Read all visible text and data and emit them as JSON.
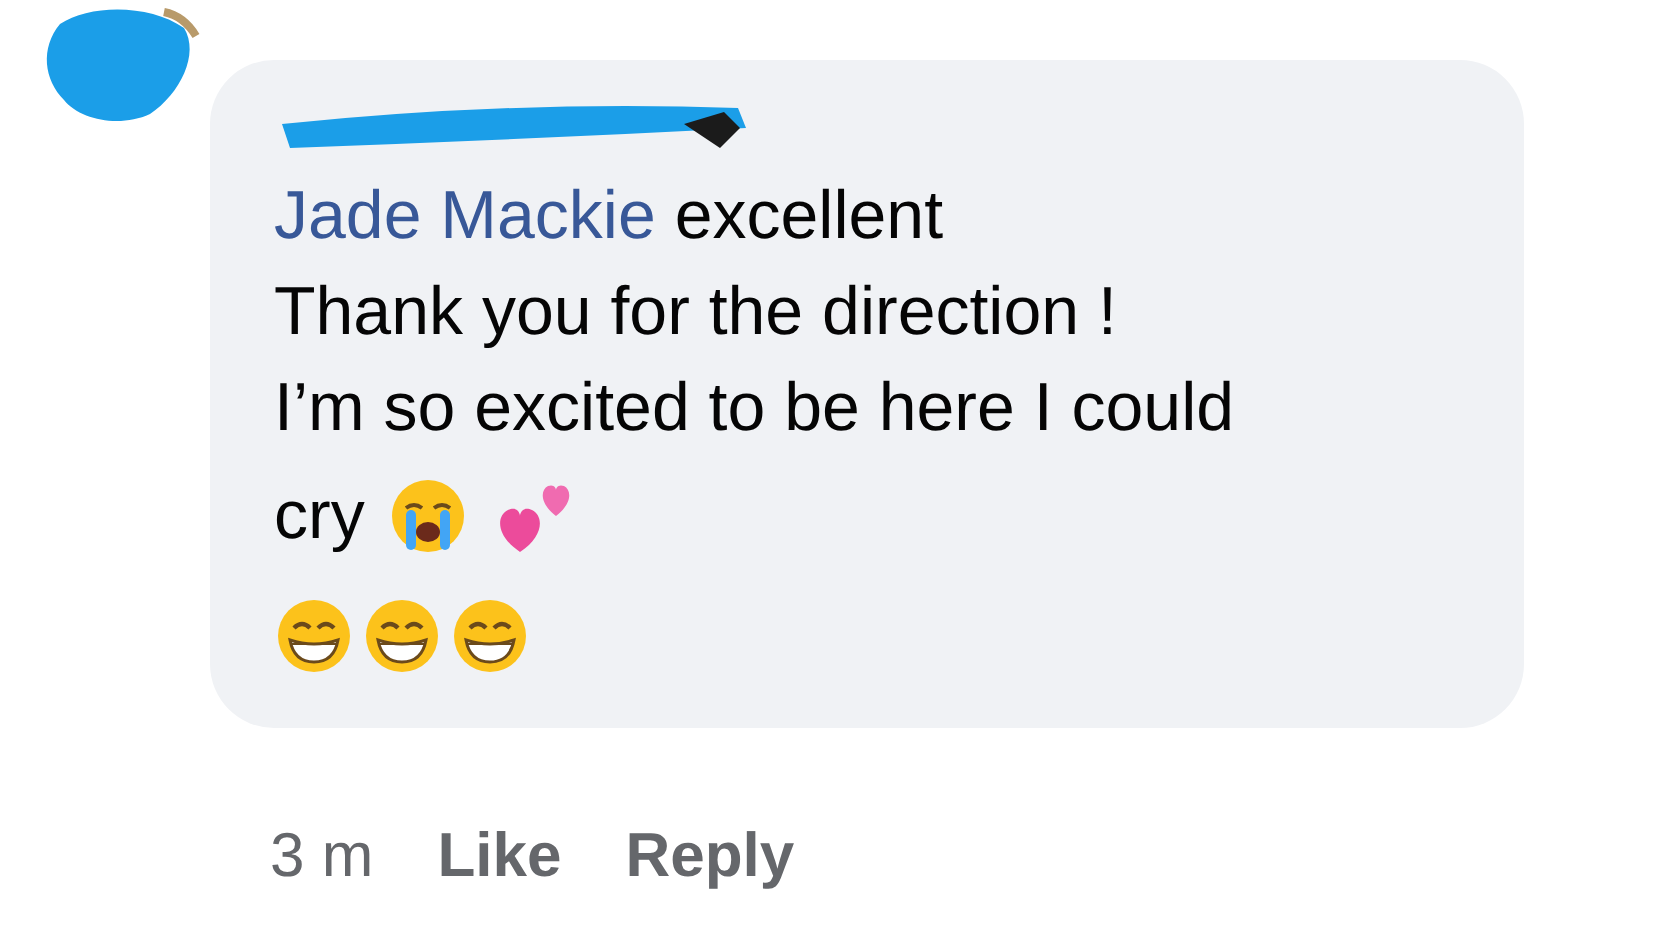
{
  "comment": {
    "lines": [
      {
        "kind": "mention",
        "mention": "Jade Mackie",
        "text": "excellent"
      },
      {
        "kind": "text",
        "text": "Thank you for the direction !"
      },
      {
        "kind": "text",
        "text": "I’m so excited to be here I could"
      },
      {
        "kind": "text-emoji",
        "text": "cry",
        "emojis": [
          {
            "kind": "crying-face"
          },
          {
            "kind": "two-hearts"
          }
        ]
      },
      {
        "kind": "emoji",
        "emojis": [
          {
            "kind": "grinning-face"
          },
          {
            "kind": "grinning-face"
          },
          {
            "kind": "grinning-face"
          }
        ]
      }
    ]
  },
  "footer": {
    "time": "3 m",
    "actions": [
      "Like",
      "Reply"
    ]
  }
}
